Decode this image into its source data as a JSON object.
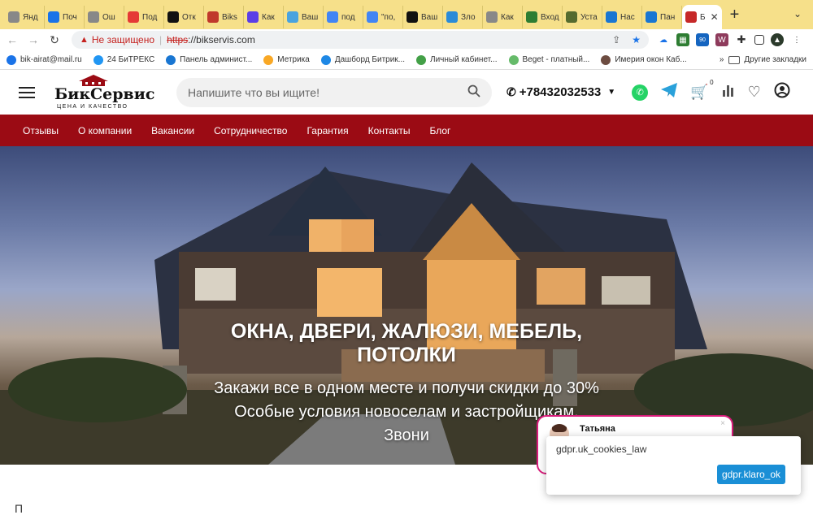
{
  "tabs": [
    {
      "label": "Янд",
      "color": "#888"
    },
    {
      "label": "Поч",
      "color": "#1a73e8"
    },
    {
      "label": "Ош",
      "color": "#888"
    },
    {
      "label": "Под",
      "color": "#e53935"
    },
    {
      "label": "Отк",
      "color": "#111"
    },
    {
      "label": "Biks",
      "color": "#c0392b"
    },
    {
      "label": "Как",
      "color": "#5b3ee6"
    },
    {
      "label": "Ваш",
      "color": "#4aa3df"
    },
    {
      "label": "под",
      "color": "#4285f4"
    },
    {
      "label": "\"по,",
      "color": "#4285f4"
    },
    {
      "label": "Ваш",
      "color": "#111"
    },
    {
      "label": "Зло",
      "color": "#2a8bd8"
    },
    {
      "label": "Как",
      "color": "#888"
    },
    {
      "label": "Вход",
      "color": "#2e7d32"
    },
    {
      "label": "Уста",
      "color": "#556b2f"
    },
    {
      "label": "Нас",
      "color": "#1976d2"
    },
    {
      "label": "Пан",
      "color": "#1976d2"
    }
  ],
  "active_tab": {
    "label": "Б",
    "color": "#c62828"
  },
  "new_tab": "+",
  "address": {
    "not_secure": "Не защищено",
    "scheme": "https",
    "host": "://bikservis.com"
  },
  "bookmarks": [
    {
      "label": "bik-airat@mail.ru",
      "color": "#1a73e8"
    },
    {
      "label": "24 БиТРЕКС",
      "color": "#2196f3"
    },
    {
      "label": "Панель админист...",
      "color": "#1976d2"
    },
    {
      "label": "Метрика",
      "color": "#f9a825"
    },
    {
      "label": "Дашборд Битрик...",
      "color": "#1e88e5"
    },
    {
      "label": "Личный кабинет...",
      "color": "#43a047"
    },
    {
      "label": "Beget - платный...",
      "color": "#66bb6a"
    },
    {
      "label": "Имерия окон Каб...",
      "color": "#6d4c41"
    }
  ],
  "bookmarks_more": "»",
  "bookmarks_folder": "Другие закладки",
  "ext_badge": "90",
  "ext_w": "W",
  "site": {
    "logo_name": "БикСервис",
    "logo_tag": "ЦЕНА И КАЧЕСТВО",
    "search_placeholder": "Напишите что вы ищите!",
    "phone": "+78432032533",
    "cart_count": "0",
    "nav": [
      "Отзывы",
      "О компании",
      "Вакансии",
      "Сотрудничество",
      "Гарантия",
      "Контакты",
      "Блог"
    ],
    "hero_title": "ОКНА, ДВЕРИ, ЖАЛЮЗИ, МЕБЕЛЬ, ПОТОЛКИ",
    "hero_subtitle": "Закажи все в одном месте и получи скидки до 30% Особые условия новоселам и застройщикам. Звони",
    "below_letter": "П"
  },
  "chat": {
    "name": "Татьяна",
    "close": "×"
  },
  "cookie": {
    "text": "gdpr.uk_cookies_law",
    "ok": "gdpr.klaro_ok"
  },
  "colors": {
    "brand_red": "#9b0b14",
    "whatsapp": "#25d366",
    "telegram": "#2aa1da",
    "chat_border": "#d81b7a",
    "cookie_button": "#1a8fd6"
  }
}
